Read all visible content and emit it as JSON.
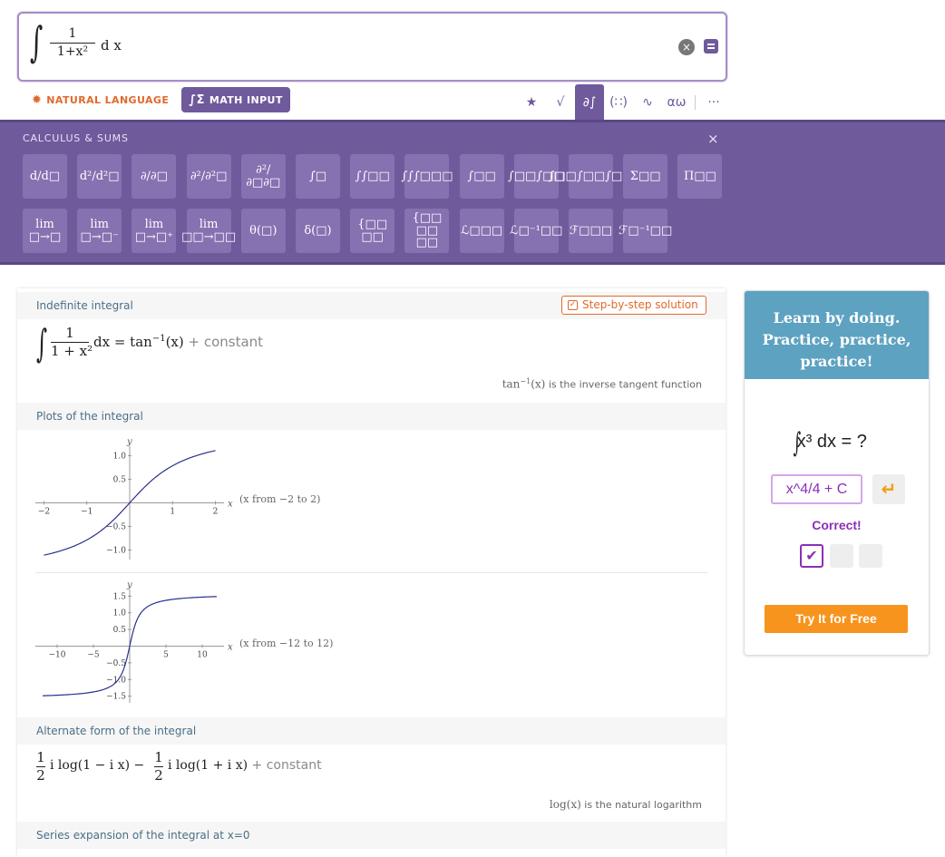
{
  "input": {
    "formula_num": "1",
    "formula_den": "1+x²",
    "formula_tail": "d x",
    "clear_label": "×"
  },
  "modes": {
    "natural_language": "NATURAL LANGUAGE",
    "math_input": "MATH INPUT"
  },
  "toolbar": {
    "items": [
      {
        "icon": "star-icon",
        "glyph": "★"
      },
      {
        "icon": "sqrt-icon",
        "glyph": "√"
      },
      {
        "icon": "calculus-icon",
        "glyph": "∂∫"
      },
      {
        "icon": "matrix-icon",
        "glyph": "(∷)"
      },
      {
        "icon": "wave-icon",
        "glyph": "∿"
      },
      {
        "icon": "greek-icon",
        "glyph": "αω"
      },
      {
        "icon": "more-icon",
        "glyph": "···"
      }
    ]
  },
  "palette": {
    "title": "CALCULUS & SUMS",
    "close": "×",
    "row1": [
      "d/d□",
      "d²/d²□",
      "∂/∂□",
      "∂²/∂²□",
      "∂²/∂□∂□",
      "∫□",
      "∫∫□□",
      "∫∫∫□□□",
      "∫□□",
      "∫□□∫□□",
      "∫□□∫□□∫□□",
      "Σ□□",
      "Π□□"
    ],
    "row2": [
      "lim □→□",
      "lim □→□⁻",
      "lim □→□⁺",
      "lim □□→□□",
      "θ(□)",
      "δ(□)",
      "{□□ □□",
      "{□□ □□ □□",
      "ℒ□□□",
      "ℒ□⁻¹□□",
      "ℱ□□□",
      "ℱ□⁻¹□□"
    ]
  },
  "results": {
    "indefinite": {
      "title": "Indefinite integral",
      "step_btn": "Step-by-step solution",
      "lhs_num": "1",
      "lhs_den": "1 + x²",
      "lhs_tail": "dx = tan",
      "rhs_sup": "−1",
      "rhs_arg": "(x)",
      "rhs_const": "+ constant",
      "note_func": "tan",
      "note_sup": "−1",
      "note_arg": "(x)",
      "note_text": " is the inverse tangent function"
    },
    "plots": {
      "title": "Plots of the integral",
      "plot1_range": "(x from −2 to 2)",
      "plot2_range": "(x from −12 to 12)"
    },
    "alternate": {
      "title": "Alternate form of the integral",
      "frac_num": "1",
      "frac_den": "2",
      "term1": "i log(1 − i x) −",
      "term2": "i log(1 + i x)",
      "const": "+ constant",
      "note_func": "log(x)",
      "note_text": " is the natural logarithm"
    },
    "series": {
      "title": "Series expansion of the integral at x=0"
    }
  },
  "chart_data": [
    {
      "type": "line",
      "title": "",
      "xlabel": "x",
      "ylabel": "y",
      "xlim": [
        -2.2,
        2.2
      ],
      "ylim": [
        -1.2,
        1.2
      ],
      "xticks": [
        -2,
        -1,
        1,
        2
      ],
      "yticks": [
        -1.0,
        -0.5,
        0.5,
        1.0
      ],
      "xtick_labels": [
        "−2",
        "−1",
        "1",
        "2"
      ],
      "ytick_labels": [
        "−1.0",
        "−0.5",
        "0.5",
        "1.0"
      ],
      "series": [
        {
          "function": "arctan",
          "x_range": [
            -2,
            2
          ],
          "color": "#2a2f8f"
        }
      ]
    },
    {
      "type": "line",
      "title": "",
      "xlabel": "x",
      "ylabel": "y",
      "xlim": [
        -13,
        13
      ],
      "ylim": [
        -1.7,
        1.7
      ],
      "xticks": [
        -10,
        -5,
        5,
        10
      ],
      "yticks": [
        -1.5,
        -1.0,
        -0.5,
        0.5,
        1.0,
        1.5
      ],
      "xtick_labels": [
        "−10",
        "−5",
        "5",
        "10"
      ],
      "ytick_labels": [
        "−1.5",
        "−1.0",
        "−0.5",
        "0.5",
        "1.0",
        "1.5"
      ],
      "series": [
        {
          "function": "arctan",
          "x_range": [
            -12,
            12
          ],
          "color": "#2a2f8f"
        }
      ]
    }
  ],
  "ad": {
    "headline": "Learn by doing. Practice, practice, practice!",
    "question_tail": "x³ dx = ?",
    "answer": "x^4/4 + C",
    "correct": "Correct!",
    "cta": "Try It for Free",
    "colors": {
      "header": "#5da2c1",
      "cta": "#f7941d",
      "accent": "#8b2fb7"
    }
  },
  "colors": {
    "brand": "#6f5a9c",
    "orange": "#e06a2c",
    "curve": "#2a2f8f"
  }
}
